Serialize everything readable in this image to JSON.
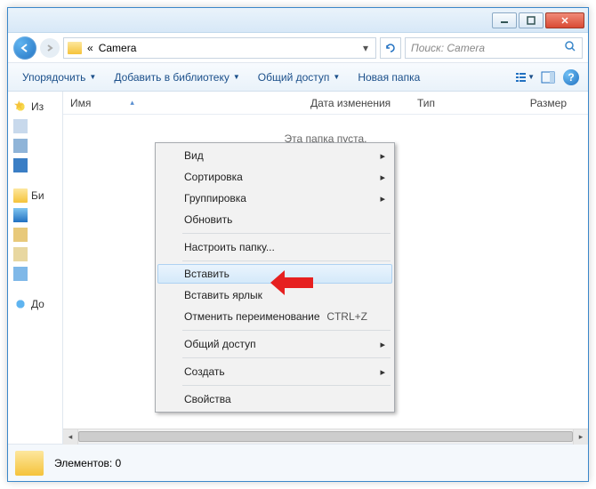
{
  "breadcrumb": {
    "prefix": "«",
    "location": "Camera"
  },
  "search": {
    "placeholder": "Поиск: Camera"
  },
  "toolbar": {
    "organize": "Упорядочить",
    "add_library": "Добавить в библиотеку",
    "share": "Общий доступ",
    "new_folder": "Новая папка"
  },
  "columns": {
    "name": "Имя",
    "date": "Дата изменения",
    "type": "Тип",
    "size": "Размер"
  },
  "empty": "Эта папка пуста.",
  "sidebar": {
    "fav": "Из",
    "lib": "Би",
    "home": "Дo"
  },
  "status": {
    "count_label": "Элементов: 0"
  },
  "context_menu": {
    "view": "Вид",
    "sort": "Сортировка",
    "group": "Группировка",
    "refresh": "Обновить",
    "customize": "Настроить папку...",
    "paste": "Вставить",
    "paste_shortcut": "Вставить ярлык",
    "undo_rename": "Отменить переименование",
    "undo_shortcut": "CTRL+Z",
    "share": "Общий доступ",
    "new": "Создать",
    "properties": "Свойства"
  }
}
